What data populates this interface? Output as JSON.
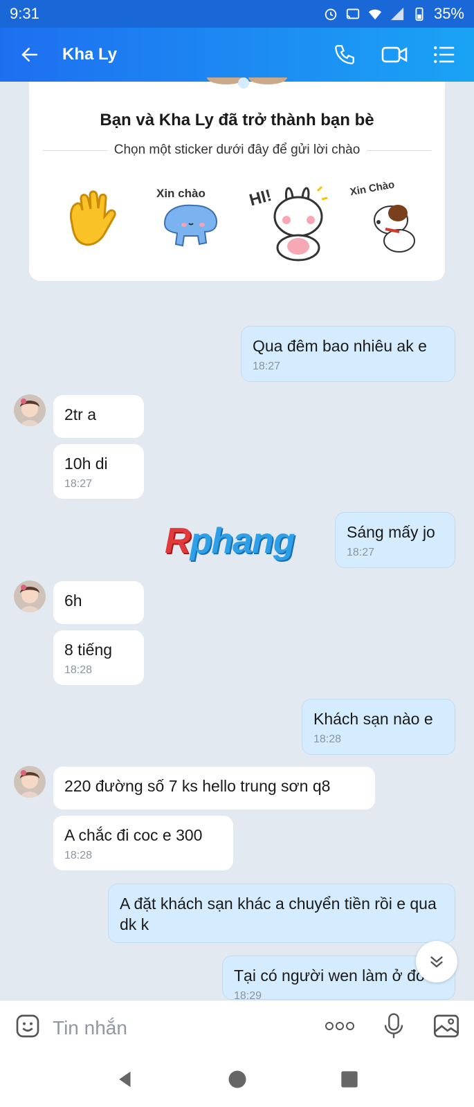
{
  "status_bar": {
    "time": "9:31",
    "battery": "35%"
  },
  "header": {
    "title": "Kha Ly"
  },
  "friend_card": {
    "title": "Bạn và Kha Ly đã trở thành bạn bè",
    "subtitle": "Chọn một sticker dưới đây để gửi lời chào",
    "stickers": [
      "wave-hand",
      "xin-chao-cat",
      "hi-bunny",
      "xin-chao-dog"
    ],
    "sticker_text": {
      "cat": "Xin chào",
      "bunny": "HI!",
      "dog": "Xin Chào"
    }
  },
  "messages": [
    {
      "id": "m1",
      "dir": "out",
      "text": "Qua đêm bao nhiêu ak e",
      "time": "18:27"
    },
    {
      "id": "m2",
      "dir": "in",
      "text": "2tr a",
      "time": ""
    },
    {
      "id": "m3",
      "dir": "in",
      "text": "10h di",
      "time": "18:27"
    },
    {
      "id": "m4",
      "dir": "out",
      "text": "Sáng mấy jo",
      "time": "18:27"
    },
    {
      "id": "m5",
      "dir": "in",
      "text": "6h",
      "time": ""
    },
    {
      "id": "m6",
      "dir": "in",
      "text": "8 tiếng",
      "time": "18:28"
    },
    {
      "id": "m7",
      "dir": "out",
      "text": "Khách sạn nào e",
      "time": "18:28"
    },
    {
      "id": "m8",
      "dir": "in",
      "text": "220 đường số 7 ks hello trung sơn q8",
      "time": ""
    },
    {
      "id": "m9",
      "dir": "in",
      "text": "A chắc đi coc e 300",
      "time": "18:28"
    },
    {
      "id": "m10",
      "dir": "out",
      "text": "A đặt khách sạn khác a chuyển tiền rồi e qua dk k",
      "time": ""
    },
    {
      "id": "m11",
      "dir": "out",
      "text": "Tại có người wen làm ở đó",
      "time": "18:29"
    }
  ],
  "watermark": {
    "r": "R",
    "rest": "phang"
  },
  "input": {
    "placeholder": "Tin nhắn"
  },
  "colors": {
    "header_start": "#1e6ff0",
    "header_end": "#1aa3f5",
    "bubble_out": "#d4ecfd",
    "bubble_in": "#ffffff",
    "background": "#e2e9f1"
  }
}
